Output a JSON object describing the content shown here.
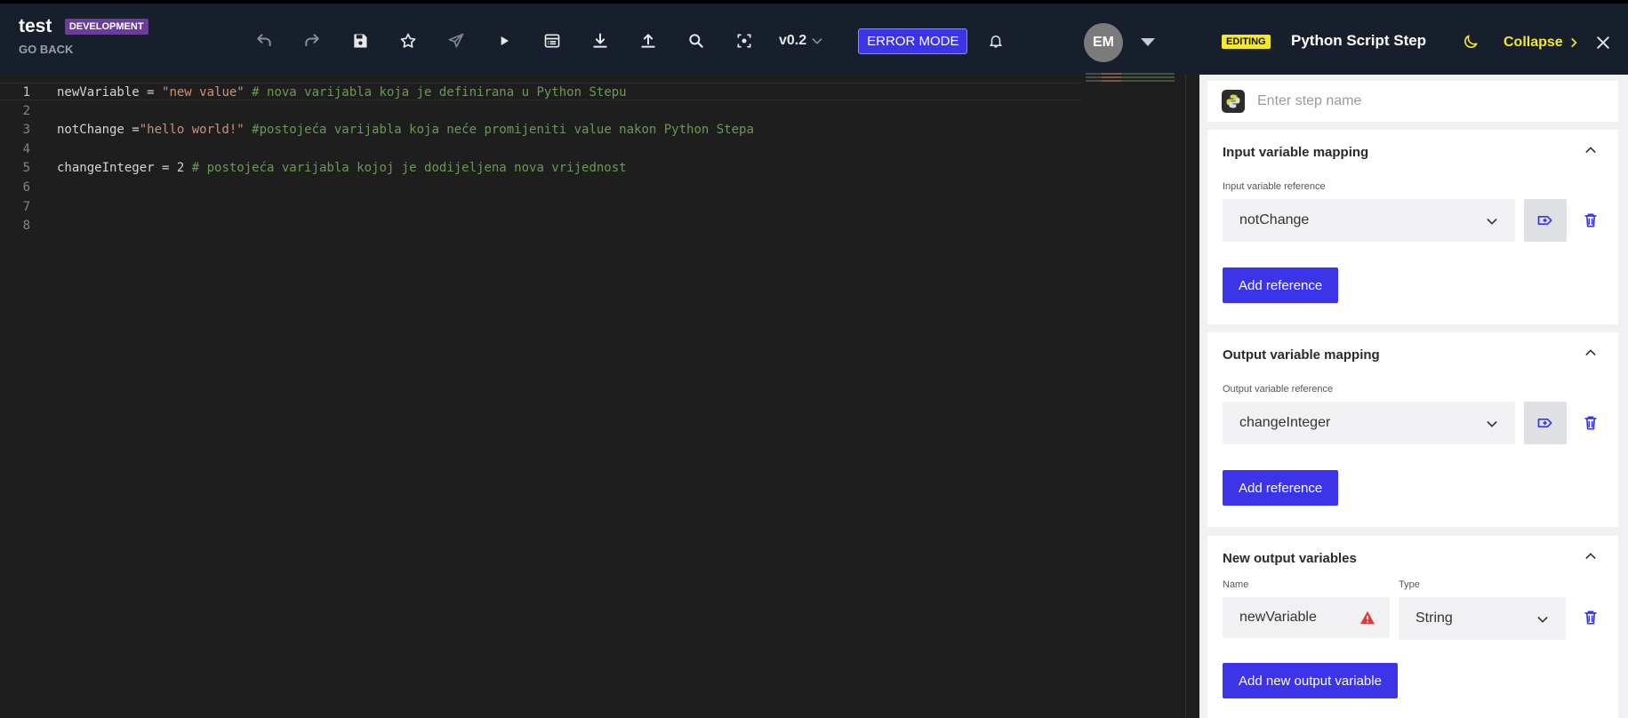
{
  "header": {
    "title": "test",
    "env_badge": "DEVELOPMENT",
    "go_back": "GO BACK",
    "version": "v0.2",
    "error_mode": "ERROR MODE",
    "avatar": "EM"
  },
  "toolbar": {
    "icons": [
      "undo-icon",
      "redo-icon",
      "save-icon",
      "star-icon",
      "send-icon",
      "play-icon",
      "table-icon",
      "download-icon",
      "upload-icon",
      "search-icon",
      "focus-icon"
    ]
  },
  "editor": {
    "line_numbers": [
      "1",
      "2",
      "3",
      "4",
      "5",
      "6",
      "7",
      "8"
    ],
    "lines": [
      {
        "code": "newVariable = ",
        "str": "\"new value\"",
        "cmt": " # nova varijabla koja je definirana u Python Stepu"
      },
      {
        "code": "",
        "str": "",
        "cmt": ""
      },
      {
        "code": "notChange =",
        "str": "\"hello world!\"",
        "cmt": " #postojeća varijabla koja neće promijeniti value nakon Python Stepa"
      },
      {
        "code": "",
        "str": "",
        "cmt": ""
      },
      {
        "code": "changeInteger = 2",
        "str": "",
        "cmt": " # postojeća varijabla kojoj je dodijeljena nova vrijednost"
      },
      {
        "code": "",
        "str": "",
        "cmt": ""
      },
      {
        "code": "",
        "str": "",
        "cmt": ""
      },
      {
        "code": "",
        "str": "",
        "cmt": ""
      }
    ]
  },
  "panel": {
    "editing_badge": "EDITING",
    "title": "Python Script Step",
    "collapse": "Collapse",
    "step_name_placeholder": "Enter step name",
    "input_mapping": {
      "title": "Input variable mapping",
      "label": "Input variable reference",
      "value": "notChange",
      "button": "Add reference"
    },
    "output_mapping": {
      "title": "Output variable mapping",
      "label": "Output variable reference",
      "value": "changeInteger",
      "button": "Add reference"
    },
    "new_outputs": {
      "title": "New output variables",
      "name_label": "Name",
      "type_label": "Type",
      "name_value": "newVariable",
      "type_value": "String",
      "button": "Add new output variable"
    }
  },
  "colors": {
    "accent": "#3b34e8",
    "header_bg": "#171e2c",
    "editing_yellow": "#f4e928",
    "warning": "#e53935"
  }
}
